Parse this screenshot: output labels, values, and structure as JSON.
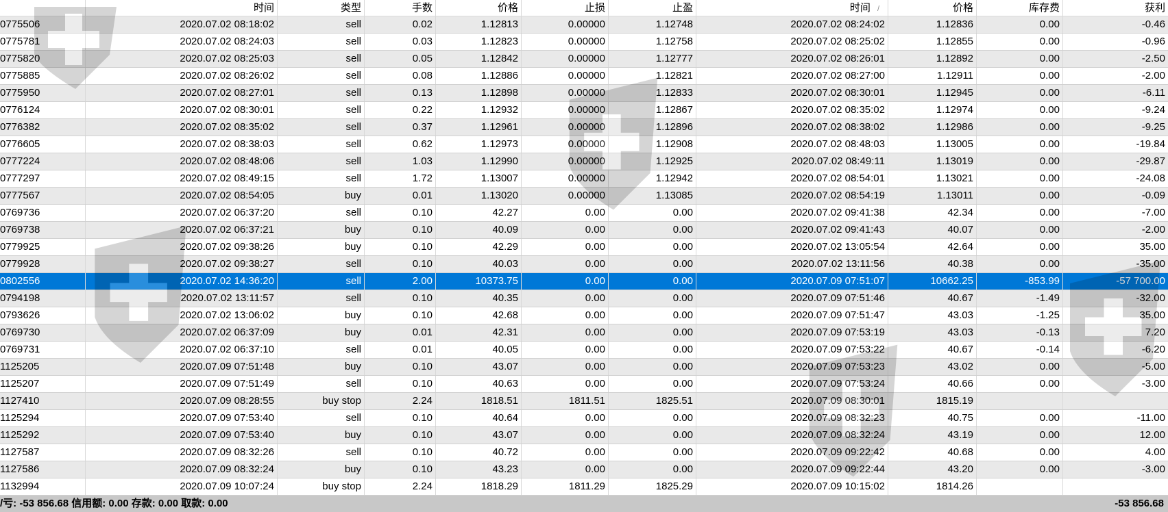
{
  "columns": [
    "",
    "时间",
    "类型",
    "手数",
    "价格",
    "止损",
    "止盈",
    "时间",
    "价格",
    "库存费",
    "获利"
  ],
  "sort_indicator": "/",
  "selected_row": 15,
  "colors": {
    "selected": "#0078d7",
    "alt_row": "#e9e9e9",
    "footer": "#c8c8c8"
  },
  "rows": [
    [
      "0775506",
      "2020.07.02 08:18:02",
      "sell",
      "0.02",
      "1.12813",
      "0.00000",
      "1.12748",
      "2020.07.02 08:24:02",
      "1.12836",
      "0.00",
      "-0.46"
    ],
    [
      "0775781",
      "2020.07.02 08:24:03",
      "sell",
      "0.03",
      "1.12823",
      "0.00000",
      "1.12758",
      "2020.07.02 08:25:02",
      "1.12855",
      "0.00",
      "-0.96"
    ],
    [
      "0775820",
      "2020.07.02 08:25:03",
      "sell",
      "0.05",
      "1.12842",
      "0.00000",
      "1.12777",
      "2020.07.02 08:26:01",
      "1.12892",
      "0.00",
      "-2.50"
    ],
    [
      "0775885",
      "2020.07.02 08:26:02",
      "sell",
      "0.08",
      "1.12886",
      "0.00000",
      "1.12821",
      "2020.07.02 08:27:00",
      "1.12911",
      "0.00",
      "-2.00"
    ],
    [
      "0775950",
      "2020.07.02 08:27:01",
      "sell",
      "0.13",
      "1.12898",
      "0.00000",
      "1.12833",
      "2020.07.02 08:30:01",
      "1.12945",
      "0.00",
      "-6.11"
    ],
    [
      "0776124",
      "2020.07.02 08:30:01",
      "sell",
      "0.22",
      "1.12932",
      "0.00000",
      "1.12867",
      "2020.07.02 08:35:02",
      "1.12974",
      "0.00",
      "-9.24"
    ],
    [
      "0776382",
      "2020.07.02 08:35:02",
      "sell",
      "0.37",
      "1.12961",
      "0.00000",
      "1.12896",
      "2020.07.02 08:38:02",
      "1.12986",
      "0.00",
      "-9.25"
    ],
    [
      "0776605",
      "2020.07.02 08:38:03",
      "sell",
      "0.62",
      "1.12973",
      "0.00000",
      "1.12908",
      "2020.07.02 08:48:03",
      "1.13005",
      "0.00",
      "-19.84"
    ],
    [
      "0777224",
      "2020.07.02 08:48:06",
      "sell",
      "1.03",
      "1.12990",
      "0.00000",
      "1.12925",
      "2020.07.02 08:49:11",
      "1.13019",
      "0.00",
      "-29.87"
    ],
    [
      "0777297",
      "2020.07.02 08:49:15",
      "sell",
      "1.72",
      "1.13007",
      "0.00000",
      "1.12942",
      "2020.07.02 08:54:01",
      "1.13021",
      "0.00",
      "-24.08"
    ],
    [
      "0777567",
      "2020.07.02 08:54:05",
      "buy",
      "0.01",
      "1.13020",
      "0.00000",
      "1.13085",
      "2020.07.02 08:54:19",
      "1.13011",
      "0.00",
      "-0.09"
    ],
    [
      "0769736",
      "2020.07.02 06:37:20",
      "sell",
      "0.10",
      "42.27",
      "0.00",
      "0.00",
      "2020.07.02 09:41:38",
      "42.34",
      "0.00",
      "-7.00"
    ],
    [
      "0769738",
      "2020.07.02 06:37:21",
      "buy",
      "0.10",
      "40.09",
      "0.00",
      "0.00",
      "2020.07.02 09:41:43",
      "40.07",
      "0.00",
      "-2.00"
    ],
    [
      "0779925",
      "2020.07.02 09:38:26",
      "buy",
      "0.10",
      "42.29",
      "0.00",
      "0.00",
      "2020.07.02 13:05:54",
      "42.64",
      "0.00",
      "35.00"
    ],
    [
      "0779928",
      "2020.07.02 09:38:27",
      "sell",
      "0.10",
      "40.03",
      "0.00",
      "0.00",
      "2020.07.02 13:11:56",
      "40.38",
      "0.00",
      "-35.00"
    ],
    [
      "0802556",
      "2020.07.02 14:36:20",
      "sell",
      "2.00",
      "10373.75",
      "0.00",
      "0.00",
      "2020.07.09 07:51:07",
      "10662.25",
      "-853.99",
      "-57 700.00"
    ],
    [
      "0794198",
      "2020.07.02 13:11:57",
      "sell",
      "0.10",
      "40.35",
      "0.00",
      "0.00",
      "2020.07.09 07:51:46",
      "40.67",
      "-1.49",
      "-32.00"
    ],
    [
      "0793626",
      "2020.07.02 13:06:02",
      "buy",
      "0.10",
      "42.68",
      "0.00",
      "0.00",
      "2020.07.09 07:51:47",
      "43.03",
      "-1.25",
      "35.00"
    ],
    [
      "0769730",
      "2020.07.02 06:37:09",
      "buy",
      "0.01",
      "42.31",
      "0.00",
      "0.00",
      "2020.07.09 07:53:19",
      "43.03",
      "-0.13",
      "7.20"
    ],
    [
      "0769731",
      "2020.07.02 06:37:10",
      "sell",
      "0.01",
      "40.05",
      "0.00",
      "0.00",
      "2020.07.09 07:53:22",
      "40.67",
      "-0.14",
      "-6.20"
    ],
    [
      "1125205",
      "2020.07.09 07:51:48",
      "buy",
      "0.10",
      "43.07",
      "0.00",
      "0.00",
      "2020.07.09 07:53:23",
      "43.02",
      "0.00",
      "-5.00"
    ],
    [
      "1125207",
      "2020.07.09 07:51:49",
      "sell",
      "0.10",
      "40.63",
      "0.00",
      "0.00",
      "2020.07.09 07:53:24",
      "40.66",
      "0.00",
      "-3.00"
    ],
    [
      "1127410",
      "2020.07.09 08:28:55",
      "buy stop",
      "2.24",
      "1818.51",
      "1811.51",
      "1825.51",
      "2020.07.09 08:30:01",
      "1815.19",
      "",
      ""
    ],
    [
      "1125294",
      "2020.07.09 07:53:40",
      "sell",
      "0.10",
      "40.64",
      "0.00",
      "0.00",
      "2020.07.09 08:32:23",
      "40.75",
      "0.00",
      "-11.00"
    ],
    [
      "1125292",
      "2020.07.09 07:53:40",
      "buy",
      "0.10",
      "43.07",
      "0.00",
      "0.00",
      "2020.07.09 08:32:24",
      "43.19",
      "0.00",
      "12.00"
    ],
    [
      "1127587",
      "2020.07.09 08:32:26",
      "sell",
      "0.10",
      "40.72",
      "0.00",
      "0.00",
      "2020.07.09 09:22:42",
      "40.68",
      "0.00",
      "4.00"
    ],
    [
      "1127586",
      "2020.07.09 08:32:24",
      "buy",
      "0.10",
      "43.23",
      "0.00",
      "0.00",
      "2020.07.09 09:22:44",
      "43.20",
      "0.00",
      "-3.00"
    ],
    [
      "1132994",
      "2020.07.09 10:07:24",
      "buy stop",
      "2.24",
      "1818.29",
      "1811.29",
      "1825.29",
      "2020.07.09 10:15:02",
      "1814.26",
      "",
      ""
    ]
  ],
  "footer": {
    "summary": "/亏: -53 856.68  信用额: 0.00  存款: 0.00  取款: 0.00",
    "total": "-53 856.68"
  }
}
